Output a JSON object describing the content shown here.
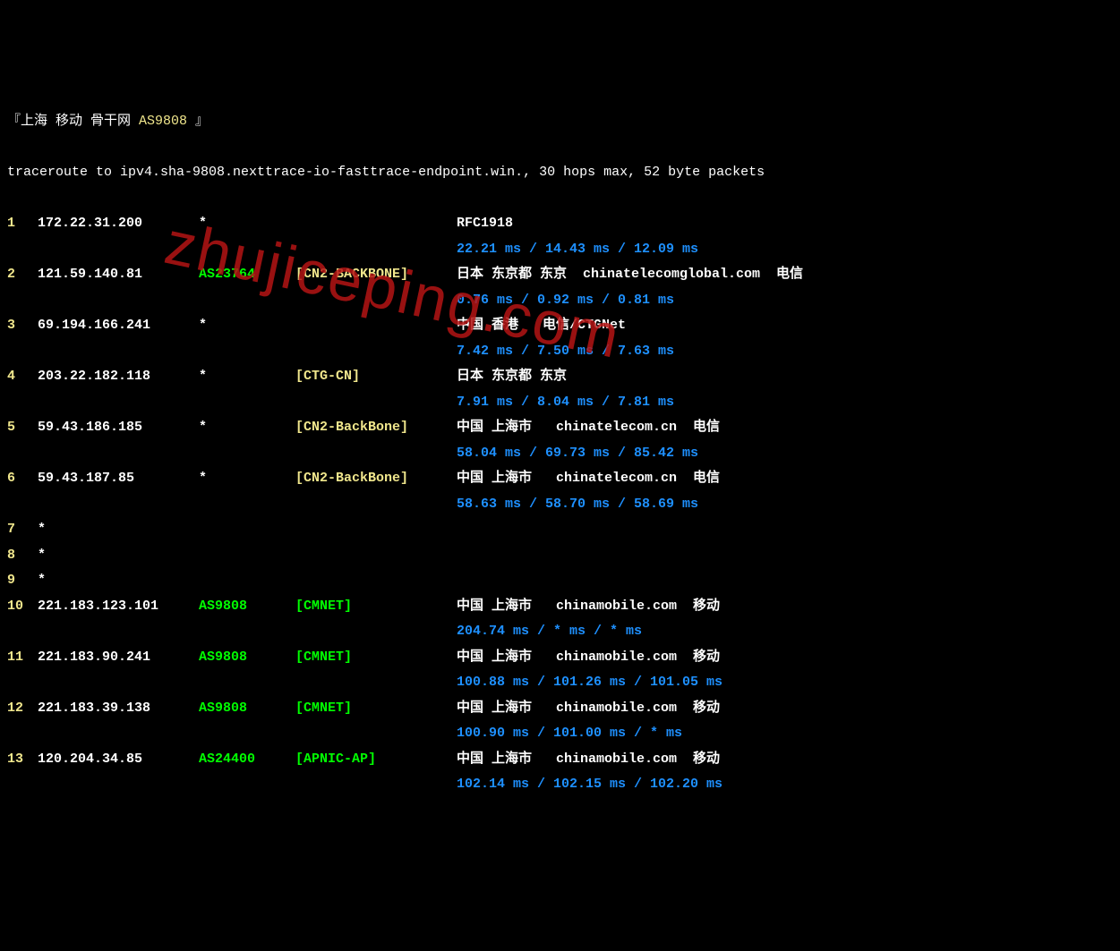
{
  "header": {
    "prefix": "『上海 移动 骨干网 ",
    "asn": "AS9808",
    "suffix": " 』"
  },
  "command": "traceroute to ipv4.sha-9808.nexttrace-io-fasttrace-endpoint.win., 30 hops max, 52 byte packets",
  "hops": [
    {
      "num": "1",
      "ip": "172.22.31.200",
      "asn": "*",
      "asn_class": "star",
      "tag": "",
      "tag_class": "",
      "location": "RFC1918",
      "latency": "22.21 ms / 14.43 ms / 12.09 ms"
    },
    {
      "num": "2",
      "ip": "121.59.140.81",
      "asn": "AS23764",
      "asn_class": "green",
      "tag": "[CN2-BACKBONE]",
      "tag_class": "yellow",
      "location": "日本 东京都 东京  chinatelecomglobal.com  电信",
      "latency": "0.76 ms / 0.92 ms / 0.81 ms"
    },
    {
      "num": "3",
      "ip": "69.194.166.241",
      "asn": "*",
      "asn_class": "star",
      "tag": "",
      "tag_class": "",
      "location": "中国 香港   电信/CTGNet",
      "latency": "7.42 ms / 7.50 ms / 7.63 ms"
    },
    {
      "num": "4",
      "ip": "203.22.182.118",
      "asn": "*",
      "asn_class": "star",
      "tag": "[CTG-CN]",
      "tag_class": "yellow",
      "location": "日本 东京都 东京",
      "latency": "7.91 ms / 8.04 ms / 7.81 ms"
    },
    {
      "num": "5",
      "ip": "59.43.186.185",
      "asn": "*",
      "asn_class": "star",
      "tag": "[CN2-BackBone]",
      "tag_class": "yellow",
      "location": "中国 上海市   chinatelecom.cn  电信",
      "latency": "58.04 ms / 69.73 ms / 85.42 ms"
    },
    {
      "num": "6",
      "ip": "59.43.187.85",
      "asn": "*",
      "asn_class": "star",
      "tag": "[CN2-BackBone]",
      "tag_class": "yellow",
      "location": "中国 上海市   chinatelecom.cn  电信",
      "latency": "58.63 ms / 58.70 ms / 58.69 ms"
    },
    {
      "num": "7",
      "star_only": true
    },
    {
      "num": "8",
      "star_only": true
    },
    {
      "num": "9",
      "star_only": true
    },
    {
      "num": "10",
      "ip": "221.183.123.101",
      "asn": "AS9808",
      "asn_class": "green",
      "tag": "[CMNET]",
      "tag_class": "green",
      "location": "中国 上海市   chinamobile.com  移动",
      "latency": "204.74 ms / * ms / * ms"
    },
    {
      "num": "11",
      "ip": "221.183.90.241",
      "asn": "AS9808",
      "asn_class": "green",
      "tag": "[CMNET]",
      "tag_class": "green",
      "location": "中国 上海市   chinamobile.com  移动",
      "latency": "100.88 ms / 101.26 ms / 101.05 ms"
    },
    {
      "num": "12",
      "ip": "221.183.39.138",
      "asn": "AS9808",
      "asn_class": "green",
      "tag": "[CMNET]",
      "tag_class": "green",
      "location": "中国 上海市   chinamobile.com  移动",
      "latency": "100.90 ms / 101.00 ms / * ms"
    },
    {
      "num": "13",
      "ip": "120.204.34.85",
      "asn": "AS24400",
      "asn_class": "green",
      "tag": "[APNIC-AP]",
      "tag_class": "green",
      "location": "中国 上海市   chinamobile.com  移动",
      "latency": "102.14 ms / 102.15 ms / 102.20 ms"
    }
  ],
  "watermark": "zhujiceping.com"
}
